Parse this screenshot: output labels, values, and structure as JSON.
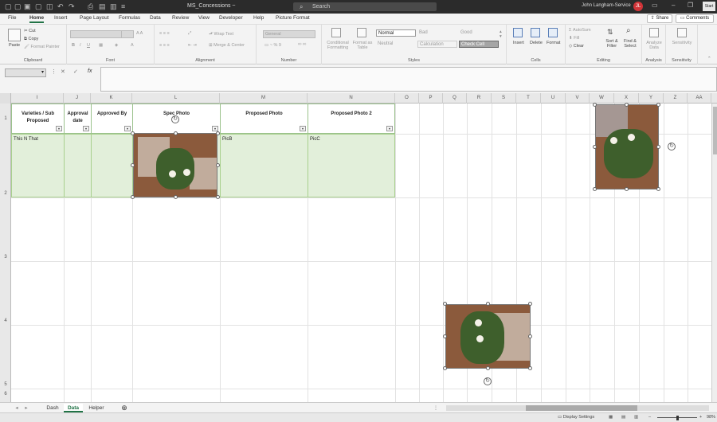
{
  "titlebar": {
    "doc_title": "MS_Concessions ~",
    "search_placeholder": "Search",
    "user_name": "John Langham-Service",
    "user_initials": "JL",
    "start_label": "Start"
  },
  "ribbon_tabs": [
    "File",
    "Home",
    "Insert",
    "Page Layout",
    "Formulas",
    "Data",
    "Review",
    "View",
    "Developer",
    "Help",
    "Picture Format"
  ],
  "active_tab": "Home",
  "share_label": "Share",
  "comments_label": "Comments",
  "clipboard": {
    "paste": "Paste",
    "cut": "Cut",
    "copy": "Copy",
    "format_painter": "Format Painter",
    "label": "Clipboard"
  },
  "font_group": {
    "label": "Font"
  },
  "alignment": {
    "wrap": "Wrap Text",
    "merge": "Merge & Center",
    "label": "Alignment"
  },
  "number": {
    "format": "General",
    "label": "Number"
  },
  "styles": {
    "cond": "Conditional Formatting",
    "format_table": "Format as Table",
    "normal": "Normal",
    "bad": "Bad",
    "good": "Good",
    "neutral": "Neutral",
    "calculation": "Calculation",
    "check_cell": "Check Cell",
    "label": "Styles"
  },
  "cells": {
    "insert": "Insert",
    "delete": "Delete",
    "format": "Format",
    "label": "Cells"
  },
  "editing": {
    "autosum": "AutoSum",
    "fill": "Fill",
    "clear": "Clear",
    "sort": "Sort & Filter",
    "find": "Find & Select",
    "label": "Editing"
  },
  "analysis": {
    "analyze": "Analyze Data",
    "label": "Analysis"
  },
  "sensitivity": {
    "btn": "Sensitivity",
    "label": "Sensitivity"
  },
  "columns": [
    "I",
    "J",
    "K",
    "L",
    "M",
    "N",
    "O",
    "P",
    "Q",
    "R",
    "S",
    "T",
    "U",
    "V",
    "W",
    "X",
    "Y",
    "Z",
    "AA"
  ],
  "rows": [
    "1",
    "2",
    "3",
    "4",
    "5",
    "6"
  ],
  "headers": {
    "varieties": "Varieties / Sub Proposed",
    "approval_date": "Approval date",
    "approved_by": "Approved By",
    "spec_photo": "Spec Photo",
    "proposed_photo": "Proposed Photo",
    "proposed_photo_2": "Proposed Photo 2"
  },
  "row_data": {
    "varieties": "This N That",
    "proposed_photo": "PicB",
    "proposed_photo_2": "PicC"
  },
  "sheet_tabs": [
    "Dash",
    "Data",
    "Helper"
  ],
  "active_sheet": "Data",
  "status": {
    "display_settings": "Display Settings",
    "zoom": "98%"
  }
}
